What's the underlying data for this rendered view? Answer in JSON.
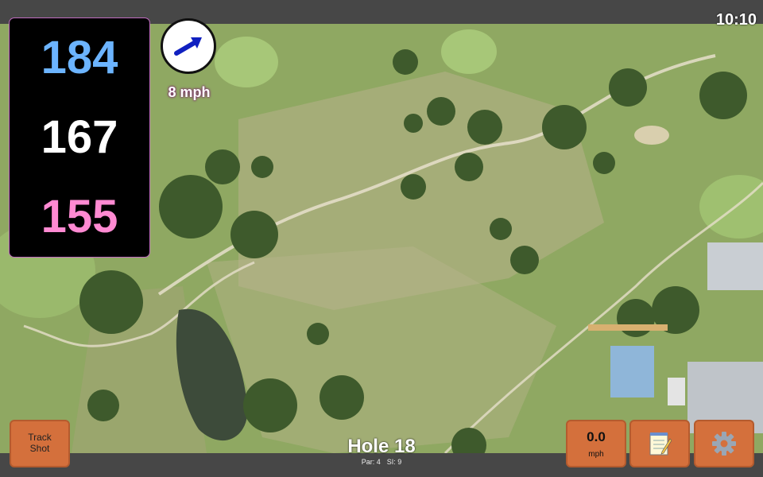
{
  "status_bar": {
    "time": "10:10"
  },
  "distances": {
    "back": "184",
    "middle": "167",
    "front": "155"
  },
  "wind": {
    "speed": "8 mph",
    "direction_icon": "wind-arrow-icon"
  },
  "buttons": {
    "track_shot": {
      "line1": "Track",
      "line2": "Shot"
    },
    "wind_value": {
      "value": "0.0",
      "unit": "mph"
    },
    "notes_icon": "notepad-icon",
    "settings_icon": "gear-icon"
  },
  "hole": {
    "title": "Hole 18",
    "par": "Par: 4",
    "si": "SI: 9"
  },
  "colors": {
    "button": "#d4703c",
    "back_distance": "#6cb4ff",
    "front_distance": "#ff8ad2",
    "frame_accent": "#c06bc0"
  }
}
